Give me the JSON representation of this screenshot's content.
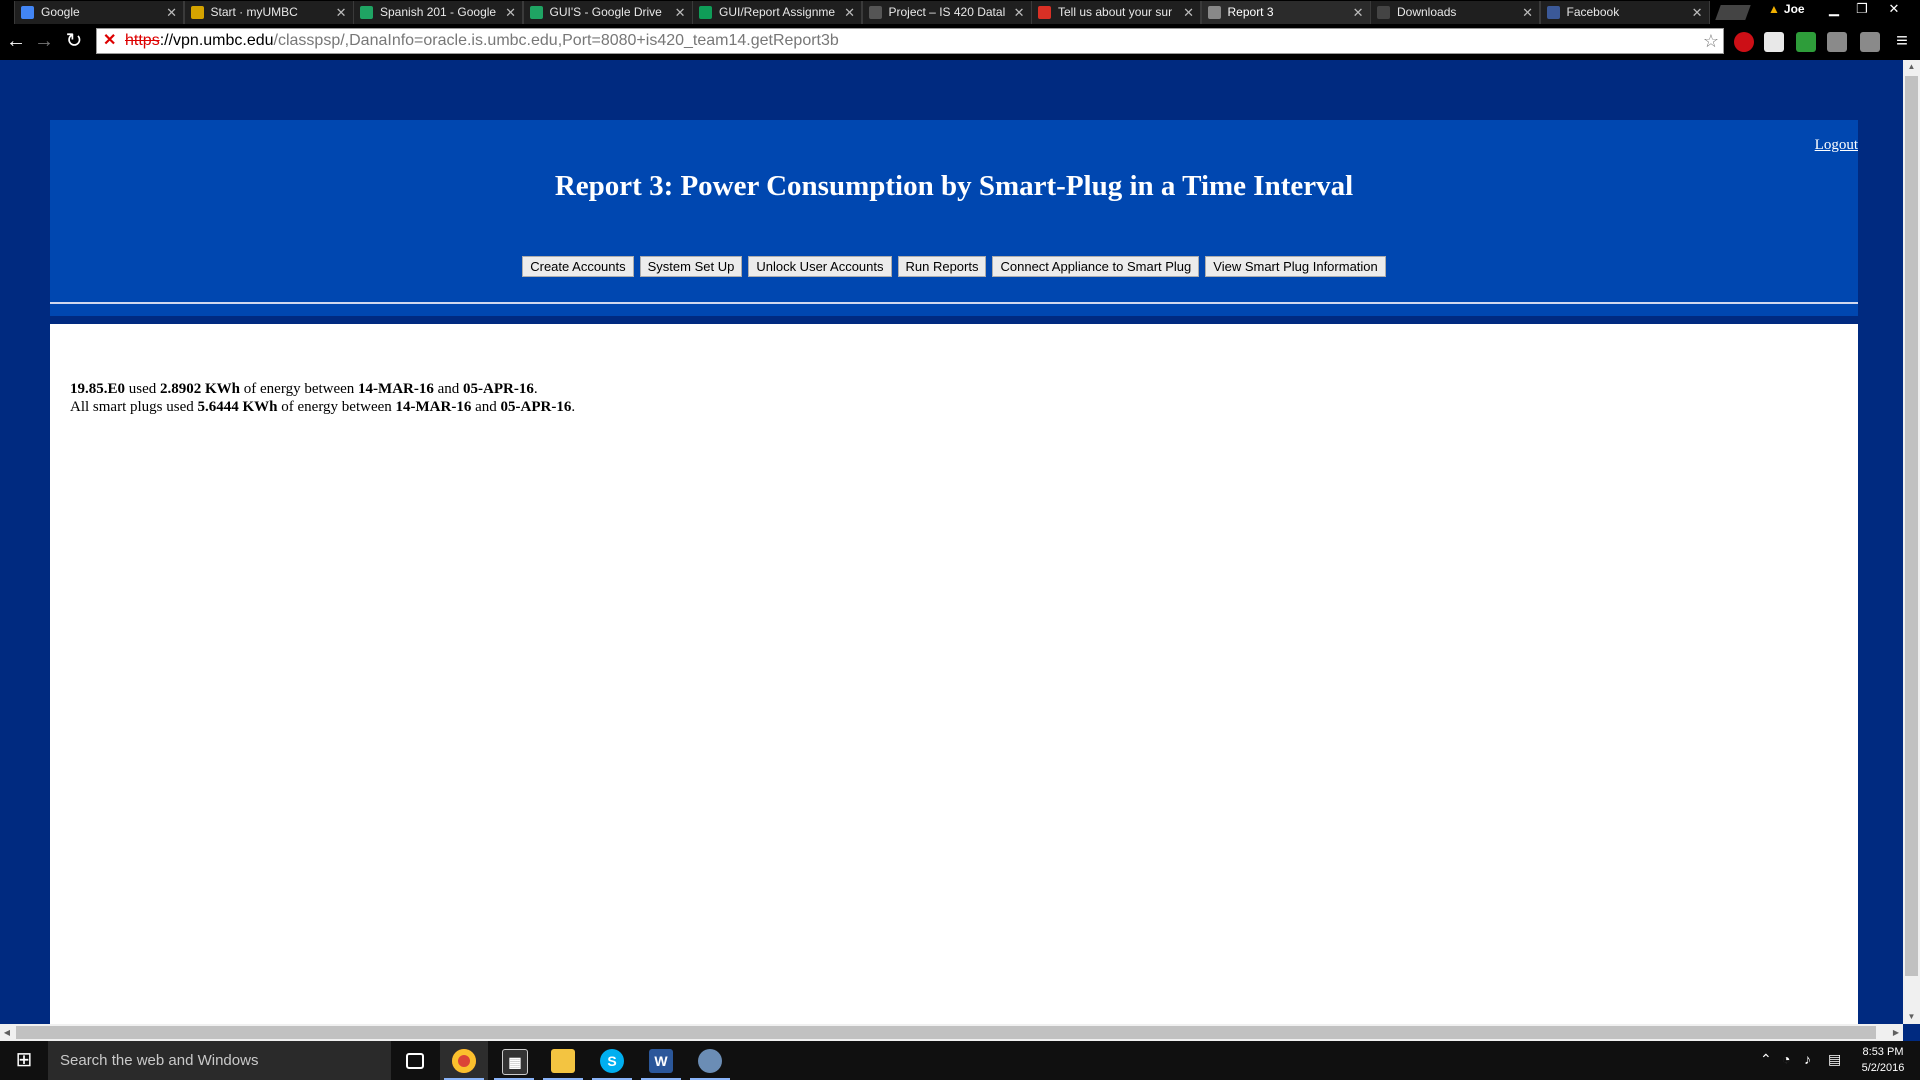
{
  "browser": {
    "tabs": [
      {
        "title": "Google",
        "icon": "google-icon",
        "color": "#4285f4",
        "active": false
      },
      {
        "title": "Start · myUMBC",
        "icon": "umbc-icon",
        "color": "#d4a300",
        "active": false
      },
      {
        "title": "Spanish 201 - Google",
        "icon": "drive-icon",
        "color": "#1fa463",
        "active": false
      },
      {
        "title": "GUI'S - Google Drive",
        "icon": "drive-icon",
        "color": "#1fa463",
        "active": false
      },
      {
        "title": "GUI/Report Assignme",
        "icon": "sheets-icon",
        "color": "#0f9d58",
        "active": false
      },
      {
        "title": "Project – IS 420 Datal",
        "icon": "blackboard-icon",
        "color": "#555555",
        "active": false
      },
      {
        "title": "Tell us about your sur",
        "icon": "gmail-icon",
        "color": "#d93025",
        "active": false
      },
      {
        "title": "Report 3",
        "icon": "page-icon",
        "color": "#888888",
        "active": true
      },
      {
        "title": "Downloads",
        "icon": "downloads-icon",
        "color": "#444444",
        "active": false
      },
      {
        "title": "Facebook",
        "icon": "facebook-icon",
        "color": "#3b5998",
        "active": false
      }
    ],
    "profile_name": "Joe",
    "url": {
      "scheme": "https",
      "rest_host": "://vpn.umbc.edu",
      "path": "/classpsp/,DanaInfo=oracle.is.umbc.edu,Port=8080+is420_team14.getReport3b"
    }
  },
  "page": {
    "logout_label": "Logout",
    "title": "Report 3: Power Consumption by Smart-Plug in a Time Interval",
    "nav_buttons": [
      "Create Accounts",
      "System Set Up",
      "Unlock User Accounts",
      "Run Reports",
      "Connect Appliance to Smart Plug",
      "View Smart Plug Information"
    ],
    "report": {
      "line1": {
        "plug_id": "19.85.E0",
        "t1": " used ",
        "energy": "2.8902 KWh",
        "t2": " of energy between ",
        "start": "14-MAR-16",
        "t3": " and ",
        "end": "05-APR-16",
        "t4": "."
      },
      "line2": {
        "t0": "All smart plugs used ",
        "energy": "5.6444 KWh",
        "t2": " of energy between ",
        "start": "14-MAR-16",
        "t3": " and ",
        "end": "05-APR-16",
        "t4": "."
      }
    },
    "colors": {
      "outer_bg": "#002a80",
      "header_bg": "#0047b0",
      "content_bg": "#ffffff"
    }
  },
  "taskbar": {
    "search_placeholder": "Search the web and Windows",
    "time": "8:53 PM",
    "date": "5/2/2016"
  }
}
